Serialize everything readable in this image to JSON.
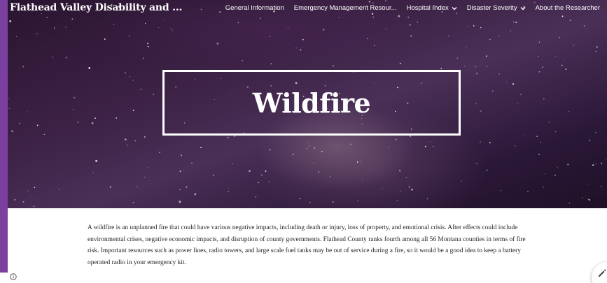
{
  "site": {
    "title": "Flathead Valley Disability and ..."
  },
  "nav": {
    "items": [
      {
        "label": "General Information",
        "has_dropdown": false
      },
      {
        "label": "Emergency Management Resour...",
        "has_dropdown": false
      },
      {
        "label": "Hospital Index",
        "has_dropdown": true
      },
      {
        "label": "Disaster Severity",
        "has_dropdown": true
      },
      {
        "label": "About the Researcher",
        "has_dropdown": false
      }
    ]
  },
  "hero": {
    "title": "Wildfire"
  },
  "content": {
    "paragraph": "A wildfire is an unplanned fire that could have various negative impacts, including death or injury, loss of property, and emotional crisis. After effects could include environmental crises, negative economic impacts, and disruption of county governments. Flathead County ranks fourth among all 56 Montana counties in terms of fire risk. Important resources such as power lines, radio towers, and large scale fuel tanks may be out of service during a fire, so it would be a good idea to keep a battery operated radio in your emergency kit."
  },
  "icons": {
    "info": "info-icon",
    "edit": "pencil-icon",
    "dropdown": "chevron-down-icon"
  },
  "colors": {
    "accent_strip": "#7b3fa0",
    "hero_text": "#ffffff",
    "body_text": "#222222"
  }
}
